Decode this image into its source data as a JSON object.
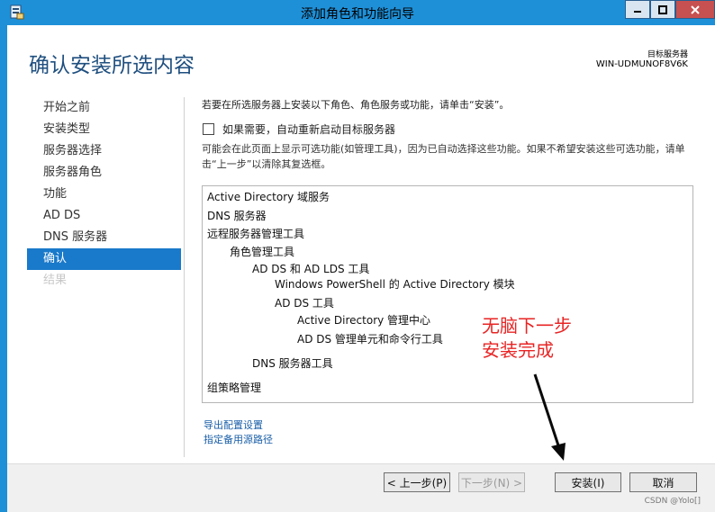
{
  "window": {
    "title": "添加角色和功能向导"
  },
  "header": {
    "page_title": "确认安装所选内容",
    "target_label": "目标服务器",
    "target_name": "WIN-UDMUNOF8V6K"
  },
  "nav": {
    "items": [
      {
        "label": "开始之前",
        "state": "normal"
      },
      {
        "label": "安装类型",
        "state": "normal"
      },
      {
        "label": "服务器选择",
        "state": "normal"
      },
      {
        "label": "服务器角色",
        "state": "normal"
      },
      {
        "label": "功能",
        "state": "normal"
      },
      {
        "label": "AD DS",
        "state": "normal"
      },
      {
        "label": "DNS 服务器",
        "state": "normal"
      },
      {
        "label": "确认",
        "state": "active"
      },
      {
        "label": "结果",
        "state": "disabled"
      }
    ]
  },
  "main": {
    "intro": "若要在所选服务器上安装以下角色、角色服务或功能，请单击“安装”。",
    "restart_checkbox": {
      "label": "如果需要，自动重新启动目标服务器",
      "checked": false
    },
    "note": "可能会在此页面上显示可选功能(如管理工具)，因为已自动选择这些功能。如果不希望安装这些可选功能，请单击“上一步”以清除其复选框。",
    "items": [
      "Active Directory 域服务",
      "DNS 服务器",
      "远程服务器管理工具",
      "角色管理工具",
      "AD DS 和 AD LDS 工具",
      "Windows PowerShell 的 Active Directory 模块",
      "AD DS 工具",
      "Active Directory 管理中心",
      "AD DS 管理单元和命令行工具",
      "DNS 服务器工具",
      "组策略管理"
    ],
    "export_link": "导出配置设置",
    "source_link": "指定备用源路径"
  },
  "buttons": {
    "prev": "< 上一步(P)",
    "next": "下一步(N) >",
    "install": "安装(I)",
    "cancel": "取消"
  },
  "annotation": {
    "line1": "无脑下一步",
    "line2": "安装完成",
    "color": "#e82424"
  },
  "watermark": "CSDN @Yolo[]"
}
